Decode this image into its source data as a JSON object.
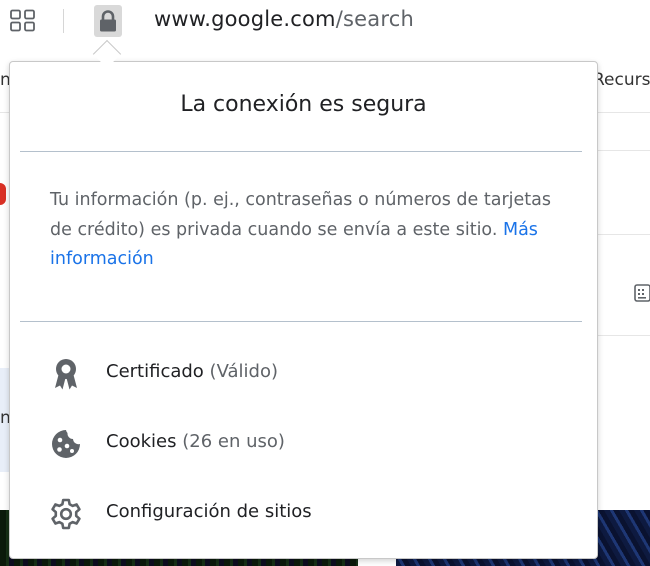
{
  "toolbar": {
    "url_host": "www.google.com",
    "url_path": "/search",
    "apps_icon": "apps-grid-icon",
    "lock_icon": "lock-icon"
  },
  "background": {
    "left_fragment_top": "n",
    "right_fragment": "Recurs",
    "left_fragment_mid": "n"
  },
  "popup": {
    "title": "La conexión es segura",
    "description": "Tu información (p. ej., contraseñas o números de tarjetas de crédito) es privada cuando se envía a este sitio.",
    "more_link": "Más información",
    "items": [
      {
        "label": "Certificado",
        "detail": "(Válido)",
        "icon": "certificate-icon"
      },
      {
        "label": "Cookies",
        "detail": "(26 en uso)",
        "icon": "cookie-icon"
      },
      {
        "label": "Configuración de sitios",
        "detail": "",
        "icon": "gear-icon"
      }
    ]
  },
  "colors": {
    "link": "#1a73e8",
    "text": "#202124",
    "secondary_text": "#5f6368",
    "icon": "#5f6368",
    "divider": "#b4c0cc"
  }
}
